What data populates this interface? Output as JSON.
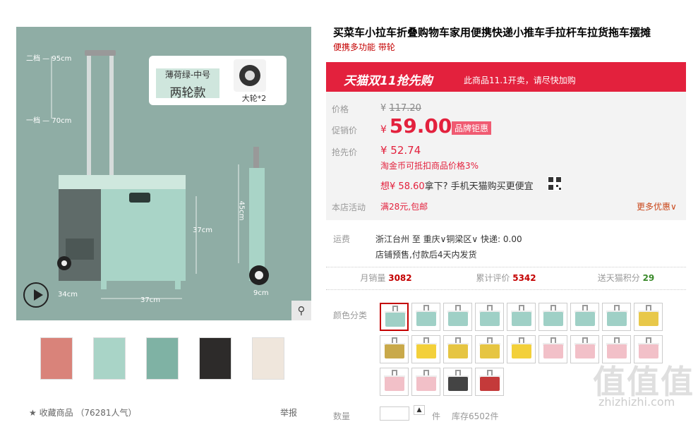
{
  "gallery": {
    "spec_name": "薄荷绿-中号",
    "spec_size": "两轮款",
    "wheel_caption": "大轮*2",
    "dims": {
      "d95": "二档 — 95cm",
      "d70": "一档 — 70cm",
      "d45": "45cm",
      "d37h": "37cm",
      "d34": "34cm",
      "d37w": "37cm",
      "d9": "9cm"
    },
    "zoom_icon": "⚲",
    "thumbnails": [
      "thumb-1",
      "thumb-2",
      "thumb-3",
      "thumb-4",
      "thumb-5"
    ],
    "favorite": "★ 收藏商品 （76281人气）",
    "report": "举报"
  },
  "product": {
    "title": "买菜车小拉车折叠购物车家用便携快递小推车手拉杆车拉货拖车摆摊",
    "subtitle": "便携多功能 带轮"
  },
  "promo": {
    "banner_title": "天猫双11抢先购",
    "banner_note": "此商品11.1开卖，请尽快加购",
    "price_label": "价格",
    "orig_currency": "¥",
    "orig_price": "117.20",
    "sale_label": "促销价",
    "sale_currency": "¥",
    "sale_price": "59.00",
    "badge": "品牌钜惠",
    "early_label": "抢先价",
    "early_price": "¥ 52.74",
    "coin_note": "淘金币可抵扣商品价格3%",
    "app_prefix": "想",
    "app_price": "¥ 58.60",
    "app_suffix": "拿下? 手机天猫购买更便宜",
    "shop_label": "本店活动",
    "shop_promo": "满28元,包邮",
    "more": "更多优惠"
  },
  "shipping": {
    "label": "运费",
    "line": "浙江台州 至 重庆∨铜梁区∨ 快递: 0.00",
    "note": "店铺预售,付款后4天内发货"
  },
  "stats": [
    {
      "label": "月销量",
      "value": "3082"
    },
    {
      "label": "累计评价",
      "value": "5342"
    },
    {
      "label": "送天猫积分",
      "value": "29"
    }
  ],
  "options": {
    "color_label": "颜色分类",
    "swatch_colors": [
      "#9fd0c6",
      "#9fd0c6",
      "#9fd0c6",
      "#9fd0c6",
      "#9fd0c6",
      "#9fd0c6",
      "#9fd0c6",
      "#9fd0c6",
      "#e8c84a",
      "#c9a94a",
      "#f3d03a",
      "#e6c542",
      "#e6c542",
      "#f3d03a",
      "#f2c0c8",
      "#f2c0c8",
      "#f2c0c8",
      "#f2c0c8",
      "#f2c0c8",
      "#f2c0c8",
      "#444444",
      "#c43a3a"
    ]
  },
  "quantity": {
    "label": "数量",
    "unit": "件",
    "stock": "库存6502件"
  },
  "watermark": {
    "text": "值值值",
    "url": "zhizhizhi.com"
  }
}
